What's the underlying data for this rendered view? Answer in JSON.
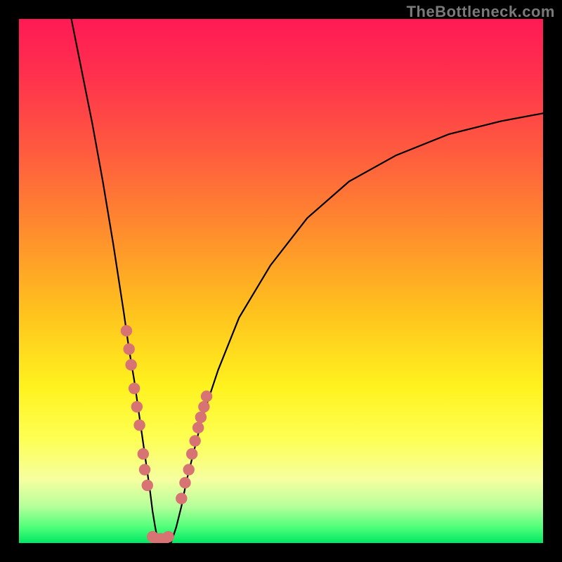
{
  "watermark": "TheBottleneck.com",
  "chart_data": {
    "type": "line",
    "title": "",
    "xlabel": "",
    "ylabel": "",
    "xlim": [
      0,
      100
    ],
    "ylim": [
      0,
      100
    ],
    "legend": false,
    "grid": false,
    "series": [
      {
        "name": "curve",
        "x": [
          10,
          12,
          14,
          16,
          18,
          20,
          21,
          22,
          23,
          24,
          25,
          25.5,
          26,
          26.6,
          27,
          28,
          29,
          30,
          31,
          32,
          33.5,
          35,
          38,
          42,
          48,
          55,
          63,
          72,
          82,
          92,
          100
        ],
        "y": [
          100,
          90,
          80,
          69,
          57,
          44,
          37,
          31,
          24,
          17,
          10,
          6,
          3,
          0,
          0,
          0,
          0,
          3,
          7,
          12,
          18,
          24,
          33,
          43,
          53,
          62,
          69,
          74,
          78,
          80.5,
          82
        ]
      }
    ],
    "scatter_left": {
      "name": "dots-left",
      "x": [
        20.5,
        21.0,
        21.4,
        22.0,
        22.5,
        23.0,
        23.7,
        24.0,
        24.5
      ],
      "y": [
        40.5,
        37.0,
        34.0,
        29.5,
        26.0,
        22.5,
        17.0,
        14.0,
        11.0
      ]
    },
    "scatter_right": {
      "name": "dots-right",
      "x": [
        31.0,
        31.7,
        32.4,
        33.0,
        33.6,
        34.2,
        34.7,
        35.3,
        35.8
      ],
      "y": [
        8.5,
        11.5,
        14.0,
        17.0,
        19.5,
        22.0,
        24.0,
        26.0,
        28.0
      ]
    },
    "scatter_bottom": {
      "name": "dots-bottom",
      "x": [
        25.5,
        26.3,
        27.0,
        27.8,
        28.5
      ],
      "y": [
        1.2,
        0.8,
        0.8,
        0.8,
        1.2
      ]
    },
    "dot_color": "#d77373",
    "dot_radius_pct": 1.1
  }
}
